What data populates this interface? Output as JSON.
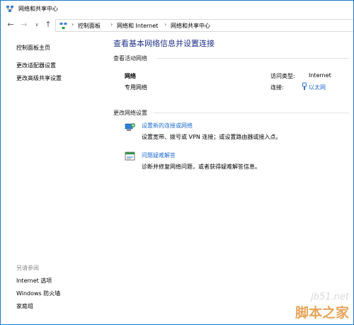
{
  "window": {
    "title": "网络和共享中心"
  },
  "address_bar": {
    "crumbs": [
      "控制面板",
      "网络和 Internet",
      "网络和共享中心"
    ],
    "separator": "›"
  },
  "nav": {
    "back": "←",
    "forward": "→",
    "dropdown": "∨",
    "up": "↑"
  },
  "sidebar": {
    "items": [
      {
        "label": "控制面板主页"
      },
      {
        "label": "更改适配器设置"
      },
      {
        "label": "更改高级共享设置"
      }
    ],
    "see_also_label": "另请参阅",
    "see_also": [
      {
        "label": "Internet 选项"
      },
      {
        "label": "Windows 防火墙"
      },
      {
        "label": "家庭组"
      }
    ]
  },
  "main": {
    "title": "查看基本网络信息并设置连接",
    "active_networks_label": "查看活动网络",
    "network": {
      "name": "网络",
      "category": "专用网络",
      "access_type_label": "访问类型:",
      "access_type_value": "Internet",
      "connection_label": "连接:",
      "connection_value": "以太网"
    },
    "change_settings_label": "更改网络设置",
    "tasks": [
      {
        "link": "设置新的连接或网络",
        "description": "设置宽带、拨号或 VPN 连接；或设置路由器或接入点。",
        "icon": "new-connection-icon"
      },
      {
        "link": "问题疑难解答",
        "description": "诊断并修复网络问题，或者获得疑难解答信息。",
        "icon": "troubleshoot-icon"
      }
    ]
  },
  "watermark": {
    "url": "jb51.net",
    "name": "脚本之家"
  },
  "colors": {
    "link": "#1f6cd1",
    "title": "#1e3287",
    "border": "#1979ca",
    "watermark_name": "#e7a45b"
  }
}
